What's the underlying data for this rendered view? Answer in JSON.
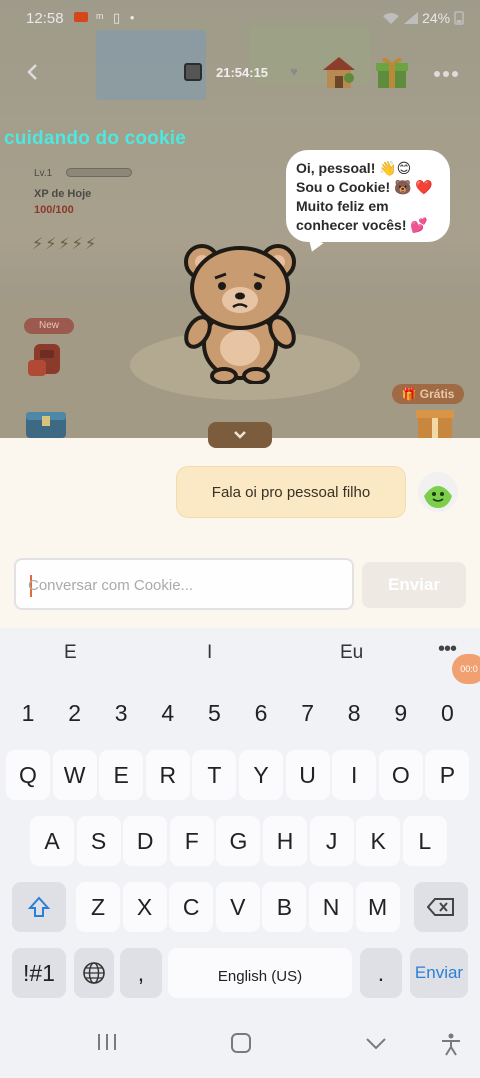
{
  "status_bar": {
    "time": "12:58",
    "stat_icons": "ᵐ ▯ •",
    "right_text": "24%"
  },
  "header": {
    "back_icon": "chevron-left-icon",
    "timer": "21:54:15",
    "title": "cuidando do cookie"
  },
  "xp": {
    "level": "Lv.1",
    "label": "XP de Hoje",
    "value": "100/100",
    "bolts": "⚡⚡⚡⚡⚡"
  },
  "badges": {
    "new": "New",
    "free": "Grátis"
  },
  "speech_bubble": "Oi, pessoal! 👋😊 Sou o Cookie! 🐻 ❤️ Muito feliz em conhecer vocês! 💕",
  "chat": {
    "user_message": "Fala oi pro pessoal filho",
    "input_placeholder": "Conversar com Cookie...",
    "send_label": "Enviar"
  },
  "keyboard": {
    "suggestions": [
      "E",
      "I",
      "Eu"
    ],
    "more": "•••",
    "rec_badge": "00:0",
    "row_numbers": [
      "1",
      "2",
      "3",
      "4",
      "5",
      "6",
      "7",
      "8",
      "9",
      "0"
    ],
    "row1": [
      "Q",
      "W",
      "E",
      "R",
      "T",
      "Y",
      "U",
      "I",
      "O",
      "P"
    ],
    "row2": [
      "A",
      "S",
      "D",
      "F",
      "G",
      "H",
      "J",
      "K",
      "L"
    ],
    "row3": [
      "Z",
      "X",
      "C",
      "V",
      "B",
      "N",
      "M"
    ],
    "symbols": "!#1",
    "comma": ",",
    "space": "English (US)",
    "period": ".",
    "enter": "Enviar"
  },
  "colors": {
    "accent_title": "#4ee8e0",
    "bubble_user": "#fbe8c4",
    "key_accent": "#2b7fd6",
    "collapse_btn": "#7b5d3e"
  }
}
